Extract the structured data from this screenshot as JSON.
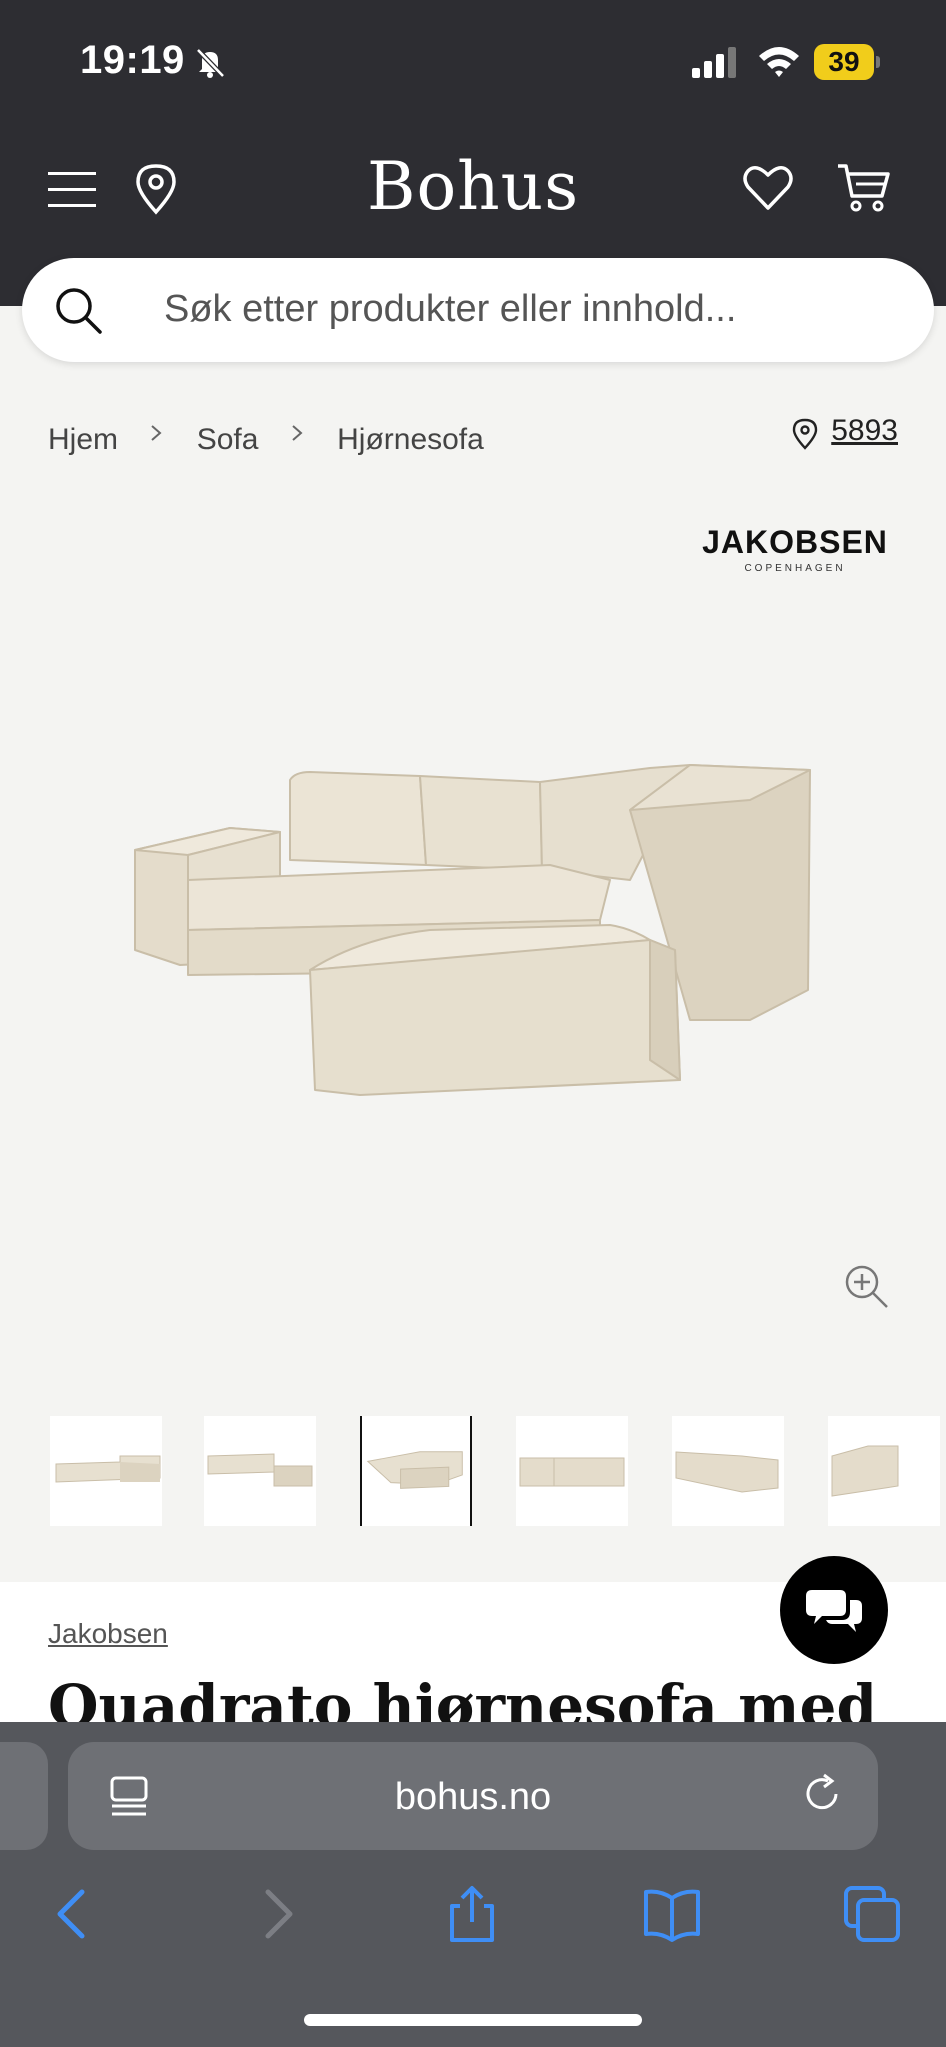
{
  "status": {
    "time": "19:19",
    "battery": "39"
  },
  "header": {
    "logo": "Bohus"
  },
  "search": {
    "placeholder": "Søk etter produkter eller innhold..."
  },
  "breadcrumb": {
    "items": [
      "Hjem",
      "Sofa",
      "Hjørnesofa"
    ],
    "store_number": "5893"
  },
  "brand_logo": {
    "name": "JAKOBSEN",
    "sub": "COPENHAGEN"
  },
  "gallery": {
    "thumbnail_count": 6,
    "selected_index": 2
  },
  "product": {
    "brand": "Jakobsen",
    "title": "Quadrato hjørnesofa med"
  },
  "browser": {
    "url": "bohus.no"
  },
  "colors": {
    "header_bg": "#2d2d32",
    "page_bg": "#f4f4f2",
    "battery": "#f1cd1b",
    "safari_blue": "#3f8ef5"
  }
}
